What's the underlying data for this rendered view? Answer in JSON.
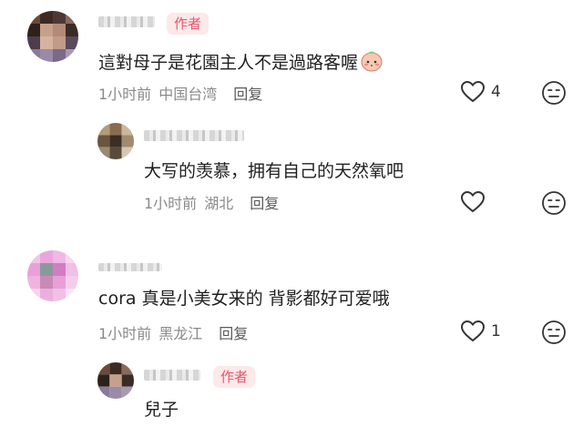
{
  "comments": [
    {
      "author_tag": "作者",
      "text": "這對母子是花園主人不是過路客喔",
      "time": "1小时前",
      "location": "中国台湾",
      "reply": "回复",
      "likes": "4"
    },
    {
      "text": "大写的羡慕，拥有自己的天然氧吧",
      "time": "1小时前",
      "location": "湖北",
      "reply": "回复"
    },
    {
      "text": "cora 真是小美女来的 背影都好可爱哦",
      "time": "1小时前",
      "location": "黑龙江",
      "reply": "回复",
      "likes": "1"
    },
    {
      "author_tag": "作者",
      "text": "兒子"
    }
  ],
  "colors": {
    "author_tag_bg": "#fde8ea",
    "author_tag_text": "#e8566a",
    "meta_gray": "#8a8a8a"
  },
  "icons": [
    "heart-outline-icon",
    "dislike-face-icon",
    "blushing-face-emoji"
  ]
}
